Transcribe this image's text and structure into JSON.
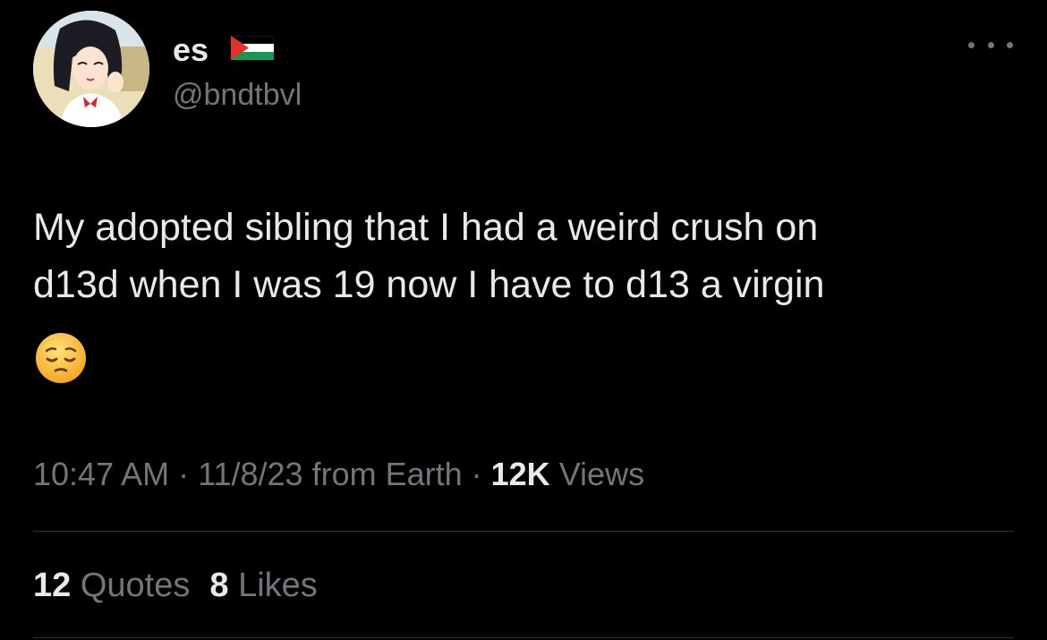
{
  "author": {
    "display_name": "es",
    "flag_icon": "palestine-flag-icon",
    "handle": "@bndtbvl",
    "avatar_icon": "anime-character-avatar"
  },
  "more_icon": "more-options-icon",
  "tweet": {
    "text": "My adopted sibling that I had a weird crush on\nd13d when I was 19 now I have to d13 a virgin",
    "emoji_icon": "pensive-face-emoji"
  },
  "meta": {
    "time": "10:47 AM",
    "separator": " · ",
    "date": "11/8/23",
    "source": "from Earth",
    "views_count": "12K",
    "views_label": "Views"
  },
  "stats": {
    "quotes_count": "12",
    "quotes_label": "Quotes",
    "likes_count": "8",
    "likes_label": "Likes"
  },
  "colors": {
    "background": "#000000",
    "primary_text": "#e7e9ea",
    "secondary_text": "#71767b",
    "divider": "#2f3336"
  }
}
